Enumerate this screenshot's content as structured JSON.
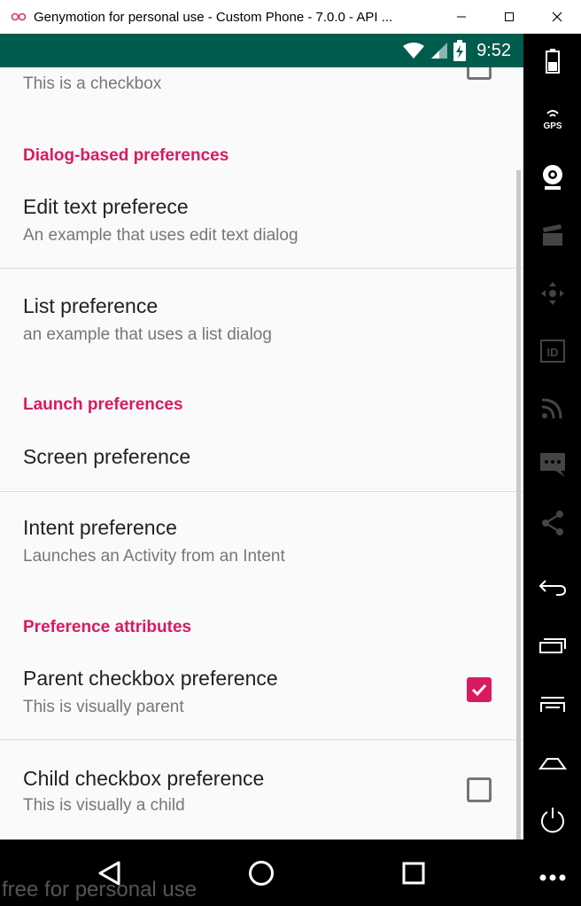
{
  "window": {
    "title": "Genymotion for personal use - Custom Phone - 7.0.0 - API ..."
  },
  "status_bar": {
    "time": "9:52"
  },
  "preferences": {
    "checkbox_item": {
      "summary": "This is a checkbox",
      "checked": false
    },
    "categories": {
      "dialog": "Dialog-based preferences",
      "launch": "Launch preferences",
      "attributes": "Preference attributes"
    },
    "edit_text": {
      "title": "Edit text preferece",
      "summary": "An example that uses edit text dialog"
    },
    "list": {
      "title": "List preference",
      "summary": "an example that uses a list dialog"
    },
    "screen": {
      "title": "Screen preference"
    },
    "intent": {
      "title": "Intent preference",
      "summary": "Launches an Activity from an Intent"
    },
    "parent_checkbox": {
      "title": "Parent checkbox preference",
      "summary": "This is visually parent",
      "checked": true
    },
    "child_checkbox": {
      "title": "Child checkbox preference",
      "summary": "This is visually a child",
      "checked": false
    }
  },
  "watermark": "free for personal use",
  "sidebar_icons": [
    "battery-icon",
    "gps-icon",
    "webcam-icon",
    "capture-icon",
    "dpad-icon",
    "id-icon",
    "cast-icon",
    "sms-icon",
    "share-icon",
    "back-icon",
    "recent-apps-icon",
    "menu-icon",
    "home-icon",
    "power-icon",
    "more-icon"
  ],
  "sidebar_labels": {
    "gps": "GPS",
    "id": "ID"
  },
  "colors": {
    "accent": "#d81b60",
    "status_bar": "#005c4c",
    "background": "#fafafa"
  }
}
